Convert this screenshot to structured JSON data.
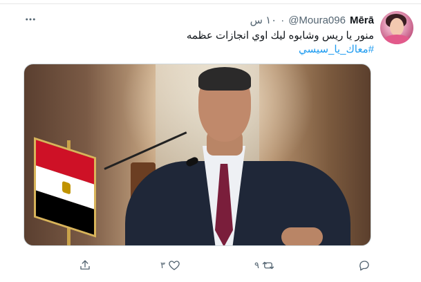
{
  "tweet": {
    "author": {
      "name": "Mērā",
      "handle": "@Moura096",
      "separator": "·",
      "time": "١٠ س"
    },
    "text": "منور يا ريس وشابوه ليك اوي انجازات عظمه",
    "hashtag": "#معاك_يا_سيسي"
  },
  "actions": {
    "reply": {
      "icon": "reply-icon",
      "count": ""
    },
    "retweet": {
      "icon": "retweet-icon",
      "count": "٩"
    },
    "like": {
      "icon": "heart-icon",
      "count": "٣"
    },
    "share": {
      "icon": "share-icon",
      "count": ""
    }
  },
  "colors": {
    "link": "#1d9bf0",
    "muted": "#536471",
    "text": "#0f1419"
  }
}
